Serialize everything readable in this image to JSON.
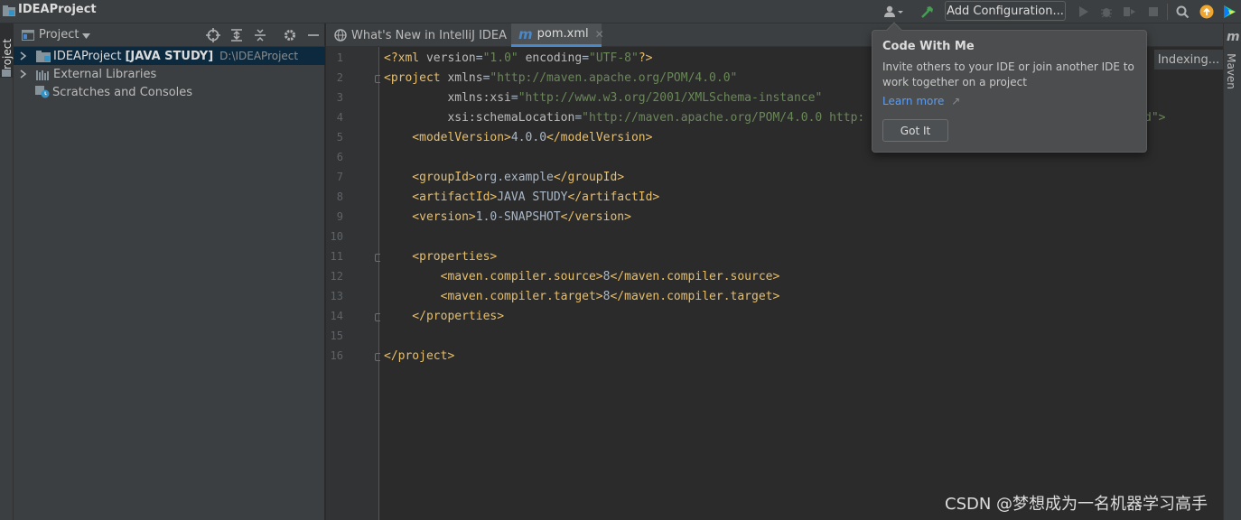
{
  "window": {
    "title": "IDEAProject"
  },
  "toolbar": {
    "add_config_label": "Add Configuration...",
    "icons": [
      "user-icon",
      "hammer-icon",
      "run-icon",
      "debug-icon",
      "coverage-icon",
      "stop-icon",
      "search-icon",
      "update-icon",
      "toolbox-icon"
    ]
  },
  "left_stripe": {
    "project_label": "Project"
  },
  "project_panel": {
    "header_label": "Project",
    "items": [
      {
        "name": "IDEAProject",
        "module": "[JAVA STUDY]",
        "path": "D:\\IDEAProject"
      },
      {
        "name": "External Libraries"
      },
      {
        "name": "Scratches and Consoles"
      }
    ]
  },
  "tabs": [
    {
      "label": "What's New in IntelliJ IDEA",
      "active": false
    },
    {
      "label": "pom.xml",
      "active": true
    }
  ],
  "editor": {
    "line_numbers": [
      "1",
      "2",
      "3",
      "4",
      "5",
      "6",
      "7",
      "8",
      "9",
      "10",
      "11",
      "12",
      "13",
      "14",
      "15",
      "16"
    ],
    "lines": [
      [
        [
          "<?xml ",
          "#e8bf6a"
        ],
        [
          "version",
          "#bababa"
        ],
        [
          "=",
          "#a9b7c6"
        ],
        [
          "\"1.0\"",
          "#6a8759"
        ],
        [
          " ",
          "#a9b7c6"
        ],
        [
          "encoding",
          "#bababa"
        ],
        [
          "=",
          "#a9b7c6"
        ],
        [
          "\"UTF-8\"",
          "#6a8759"
        ],
        [
          "?>",
          "#e8bf6a"
        ]
      ],
      [
        [
          "<project ",
          "#e8bf6a"
        ],
        [
          "xmlns",
          "#bababa"
        ],
        [
          "=",
          "#a9b7c6"
        ],
        [
          "\"http://maven.apache.org/POM/4.0.0\"",
          "#6a8759"
        ]
      ],
      [
        [
          "         xmlns:xsi",
          "#bababa"
        ],
        [
          "=",
          "#a9b7c6"
        ],
        [
          "\"http://www.w3.org/2001/XMLSchema-instance\"",
          "#6a8759"
        ]
      ],
      [
        [
          "         xsi:schemaLocation",
          "#bababa"
        ],
        [
          "=",
          "#a9b7c6"
        ],
        [
          "\"http://maven.apache.org/POM/4.0.0 http:",
          "#6a8759"
        ]
      ],
      [
        [
          "    <modelVersion>",
          "#e8bf6a"
        ],
        [
          "4.0.0",
          "#a9b7c6"
        ],
        [
          "</modelVersion>",
          "#e8bf6a"
        ]
      ],
      [],
      [
        [
          "    <groupId>",
          "#e8bf6a"
        ],
        [
          "org.example",
          "#a9b7c6"
        ],
        [
          "</groupId>",
          "#e8bf6a"
        ]
      ],
      [
        [
          "    <artifactId>",
          "#e8bf6a"
        ],
        [
          "JAVA STUDY",
          "#a9b7c6"
        ],
        [
          "</artifactId>",
          "#e8bf6a"
        ]
      ],
      [
        [
          "    <version>",
          "#e8bf6a"
        ],
        [
          "1.0-SNAPSHOT",
          "#a9b7c6"
        ],
        [
          "</version>",
          "#e8bf6a"
        ]
      ],
      [],
      [
        [
          "    <properties>",
          "#e8bf6a"
        ]
      ],
      [
        [
          "        <maven.compiler.source>",
          "#e8bf6a"
        ],
        [
          "8",
          "#a9b7c6"
        ],
        [
          "</maven.compiler.source>",
          "#e8bf6a"
        ]
      ],
      [
        [
          "        <maven.compiler.target>",
          "#e8bf6a"
        ],
        [
          "8",
          "#a9b7c6"
        ],
        [
          "</maven.compiler.target>",
          "#e8bf6a"
        ]
      ],
      [
        [
          "    </properties>",
          "#e8bf6a"
        ]
      ],
      [],
      [
        [
          "</project>",
          "#e8bf6a"
        ]
      ]
    ],
    "line4_tail": "d\">",
    "indexing_label": "Indexing..."
  },
  "right_stripe": {
    "maven_label": "Maven"
  },
  "popup": {
    "title": "Code With Me",
    "body": "Invite others to your IDE or join another IDE to work together on a project",
    "link": "Learn more",
    "link_arrow": "↗",
    "button": "Got It"
  },
  "watermark": "CSDN @梦想成为一名机器学习高手",
  "colors": {
    "accent": "#4a88c7",
    "selection": "#0d293e",
    "tag": "#e8bf6a",
    "string": "#6a8759"
  }
}
